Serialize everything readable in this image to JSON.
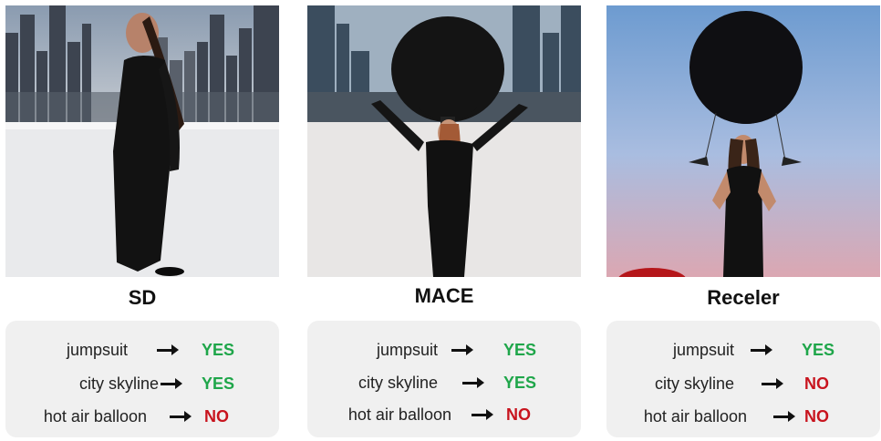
{
  "columns": [
    {
      "id": "sd",
      "title": "SD",
      "rows": [
        {
          "label": "jumpsuit",
          "answer": "YES"
        },
        {
          "label": "city skyline",
          "answer": "YES"
        },
        {
          "label": "hot air balloon",
          "answer": "NO"
        }
      ]
    },
    {
      "id": "mace",
      "title": "MACE",
      "rows": [
        {
          "label": "jumpsuit",
          "answer": "YES"
        },
        {
          "label": "city skyline",
          "answer": "YES"
        },
        {
          "label": "hot air balloon",
          "answer": "NO"
        }
      ]
    },
    {
      "id": "receler",
      "title": "Receler",
      "rows": [
        {
          "label": "jumpsuit",
          "answer": "YES"
        },
        {
          "label": "city skyline",
          "answer": "NO"
        },
        {
          "label": "hot air balloon",
          "answer": "NO"
        }
      ]
    }
  ],
  "colors": {
    "yes": "#1fa64a",
    "no": "#c8141e",
    "panel": "#f0f0f0"
  }
}
